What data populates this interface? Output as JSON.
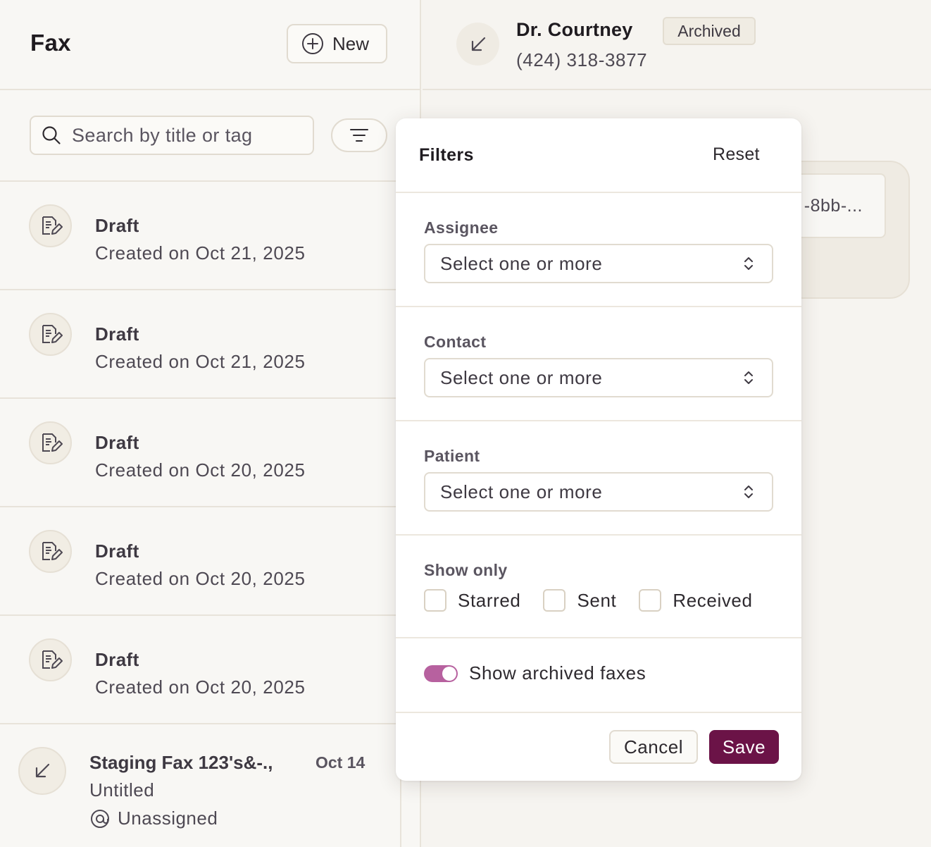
{
  "app": {
    "title": "Fax",
    "new_button_label": "New"
  },
  "search": {
    "placeholder": "Search by title or tag"
  },
  "fax_list": [
    {
      "title": "Draft",
      "subtitle": "Created on Oct 21, 2025",
      "icon": "draft-document-icon"
    },
    {
      "title": "Draft",
      "subtitle": "Created on Oct 21, 2025",
      "icon": "draft-document-icon"
    },
    {
      "title": "Draft",
      "subtitle": "Created on Oct 20, 2025",
      "icon": "draft-document-icon"
    },
    {
      "title": "Draft",
      "subtitle": "Created on Oct 20, 2025",
      "icon": "draft-document-icon"
    },
    {
      "title": "Draft",
      "subtitle": "Created on Oct 20, 2025",
      "icon": "draft-document-icon"
    },
    {
      "title": "Staging Fax 123's&-.,",
      "subtitle": "Untitled",
      "date": "Oct 14",
      "assignee": "Unassigned",
      "icon": "incoming-arrow-icon"
    }
  ],
  "detail": {
    "contact_name": "Dr. Courtney",
    "phone": "(424) 318-3877",
    "status_badge": "Archived",
    "background_chip_text": "-8bb-..."
  },
  "filters": {
    "title": "Filters",
    "reset_label": "Reset",
    "assignee": {
      "label": "Assignee",
      "placeholder": "Select one or more"
    },
    "contact": {
      "label": "Contact",
      "placeholder": "Select one or more"
    },
    "patient": {
      "label": "Patient",
      "placeholder": "Select one or more"
    },
    "show_only": {
      "label": "Show only",
      "options": [
        {
          "label": "Starred",
          "checked": false
        },
        {
          "label": "Sent",
          "checked": false
        },
        {
          "label": "Received",
          "checked": false
        }
      ]
    },
    "show_archived": {
      "label": "Show archived faxes",
      "enabled": true
    },
    "cancel_label": "Cancel",
    "save_label": "Save"
  },
  "colors": {
    "accent": "#6b1347",
    "toggle_on": "#b7619f",
    "background": "#f6f4f0"
  }
}
